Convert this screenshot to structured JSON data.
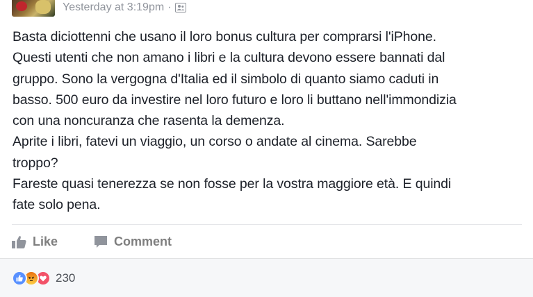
{
  "post": {
    "timestamp": "Yesterday at 3:19pm",
    "separator": "·",
    "audience_icon": "group-audience-icon",
    "body_lines": [
      "Basta diciottenni che usano il loro bonus cultura per comprarsi l'iPhone.",
      "Questi utenti che non amano i libri e la cultura devono essere bannati dal",
      "gruppo. Sono la vergogna d'Italia ed il simbolo di quanto siamo caduti in",
      "basso. 500 euro da investire nel loro futuro e loro li buttano nell'immondizia",
      "con una noncuranza che rasenta la demenza.",
      "Aprite i libri, fatevi un viaggio, un corso o andate al cinema. Sarebbe",
      "troppo?",
      "Fareste quasi tenerezza se non fosse per la vostra maggiore età. E quindi",
      "fate solo pena."
    ]
  },
  "actions": {
    "like_label": "Like",
    "comment_label": "Comment"
  },
  "reactions": {
    "types": [
      "like",
      "angry",
      "love"
    ],
    "count": "230"
  },
  "colors": {
    "text": "#1d2129",
    "meta": "#90949c",
    "action": "#7f7f7f",
    "like_blue": "#5890ff",
    "love_red": "#f25268",
    "footer_bg": "#f6f7f9"
  }
}
